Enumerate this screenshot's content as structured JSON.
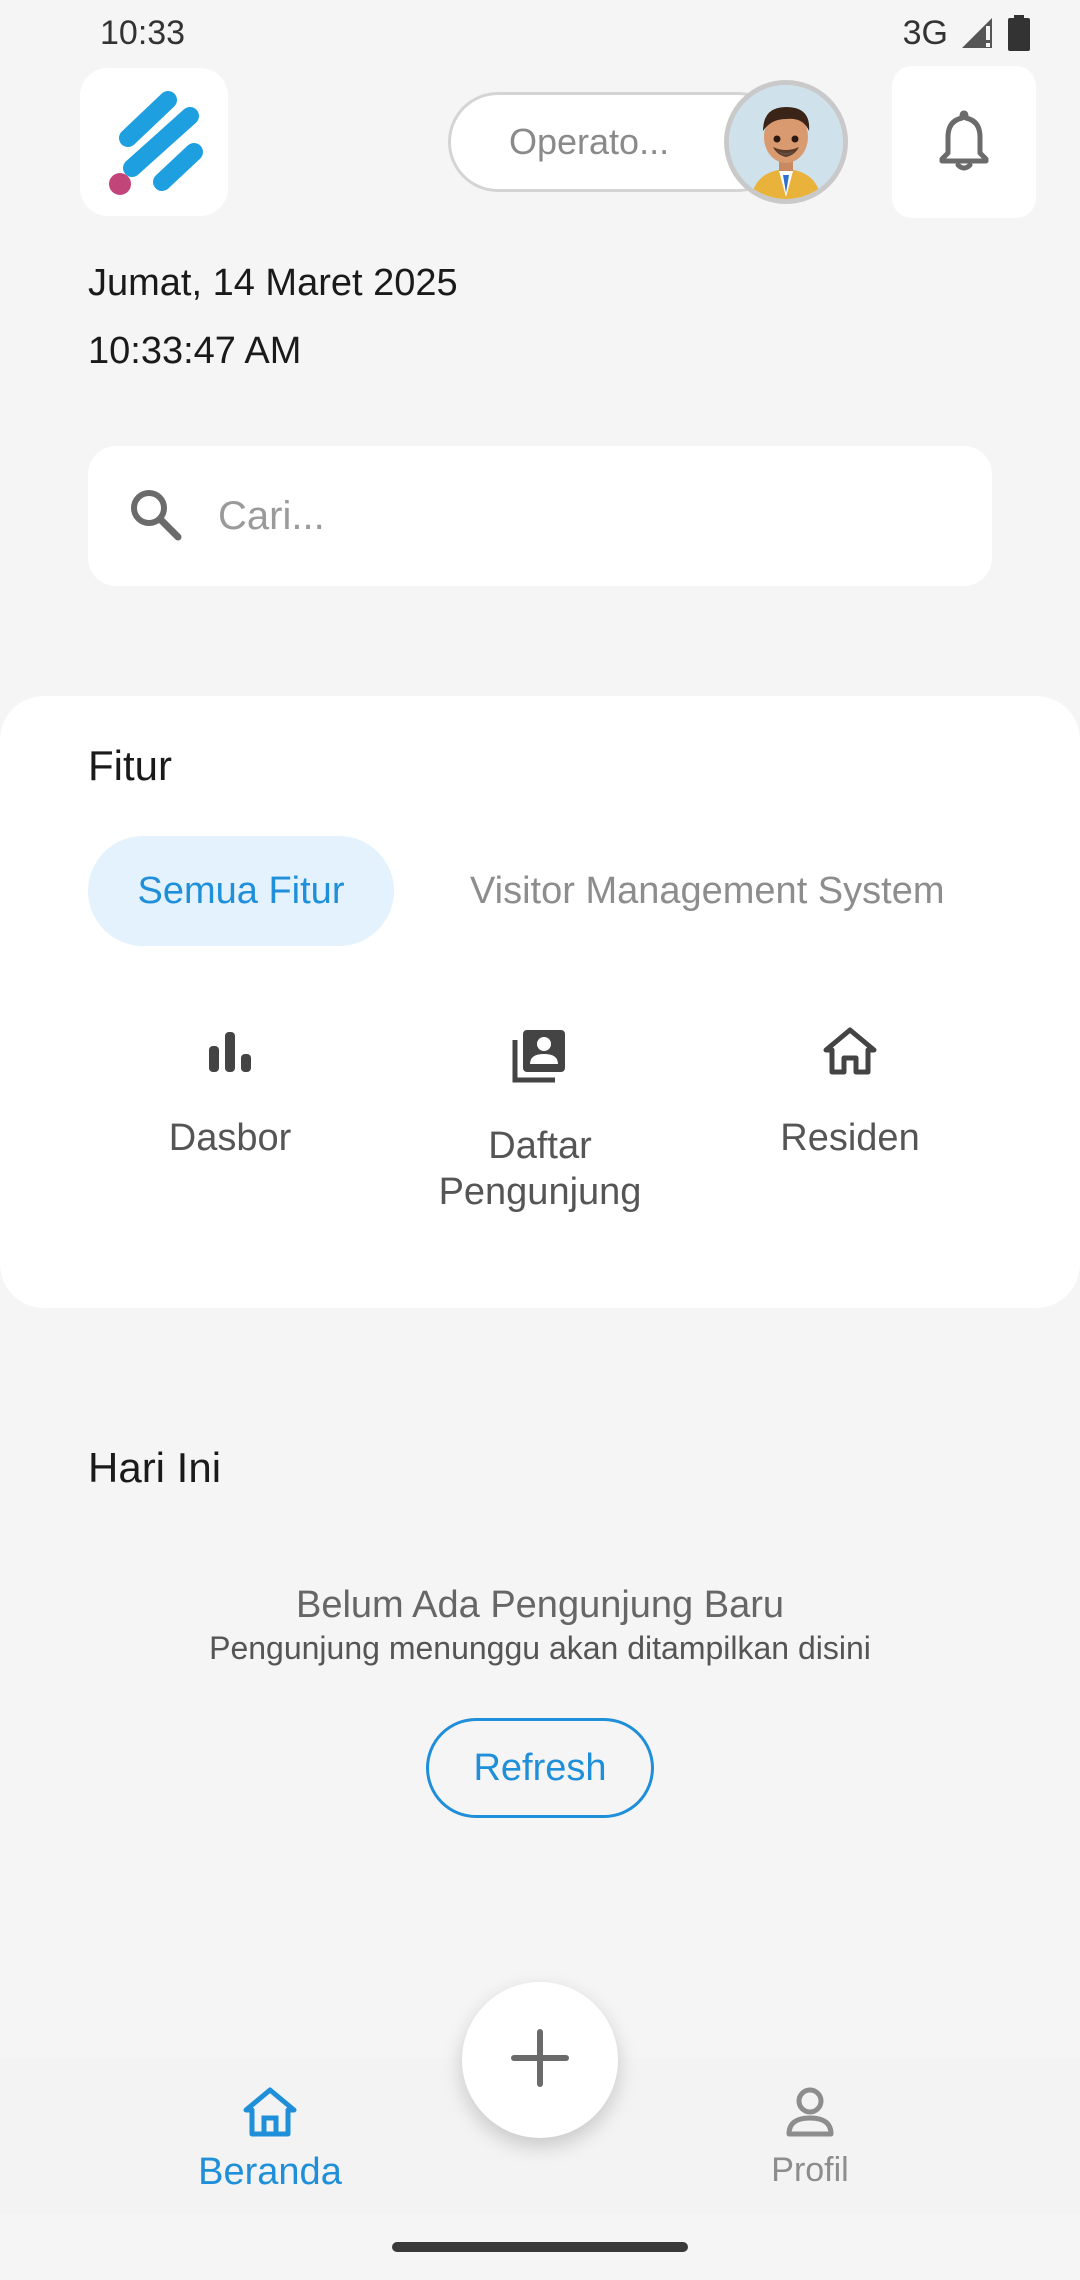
{
  "status_bar": {
    "time": "10:33",
    "network": "3G"
  },
  "header": {
    "role": "Operato...",
    "avatar": "avatar",
    "notification_icon": "bell-icon"
  },
  "datetime": {
    "date": "Jumat, 14 Maret 2025",
    "time": "10:33:47 AM"
  },
  "search": {
    "placeholder": "Cari..."
  },
  "features": {
    "title": "Fitur",
    "tabs": [
      {
        "label": "Semua Fitur",
        "active": true
      },
      {
        "label": "Visitor Management System",
        "active": false
      }
    ],
    "items": [
      {
        "label": "Dasbor",
        "icon": "bar-chart-icon"
      },
      {
        "label": "Daftar Pengunjung",
        "icon": "visitor-list-icon"
      },
      {
        "label": "Residen",
        "icon": "home-icon"
      }
    ]
  },
  "today": {
    "title": "Hari Ini",
    "empty_title": "Belum Ada Pengunjung Baru",
    "empty_subtitle": "Pengunjung menunggu akan ditampilkan disini",
    "refresh_label": "Refresh"
  },
  "bottom_nav": {
    "items": [
      {
        "label": "Beranda",
        "icon": "home-icon",
        "active": true
      },
      {
        "label": "Profil",
        "icon": "person-icon",
        "active": false
      }
    ],
    "fab_icon": "plus-icon"
  },
  "colors": {
    "accent": "#1e8fd8",
    "chip_bg": "#e3f2fc",
    "background": "#f5f5f5"
  }
}
